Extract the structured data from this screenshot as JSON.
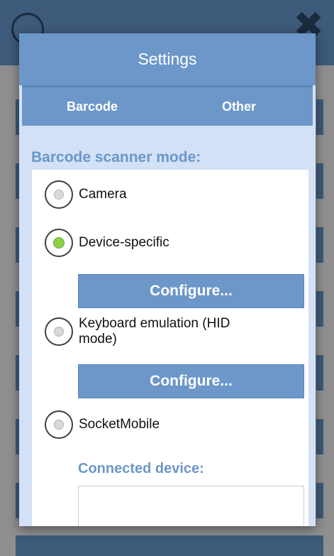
{
  "dialog": {
    "title": "Settings",
    "tabs": [
      {
        "label": "Barcode"
      },
      {
        "label": "Other"
      }
    ],
    "scanner_mode_label": "Barcode scanner mode:",
    "options": [
      {
        "label": "Camera",
        "selected": false
      },
      {
        "label": "Device-specific",
        "selected": true
      },
      {
        "label": "Keyboard emulation (HID mode)",
        "selected": false
      },
      {
        "label": "SocketMobile",
        "selected": false
      }
    ],
    "configure_buttons": [
      {
        "label": "Configure..."
      },
      {
        "label": "Configure..."
      }
    ],
    "connected_device_label": "Connected device:",
    "connected_device_value": ""
  },
  "colors": {
    "accent": "#6c97c8",
    "panel_bg": "#d2e1f5",
    "selected_radio": "#8bd14a"
  }
}
